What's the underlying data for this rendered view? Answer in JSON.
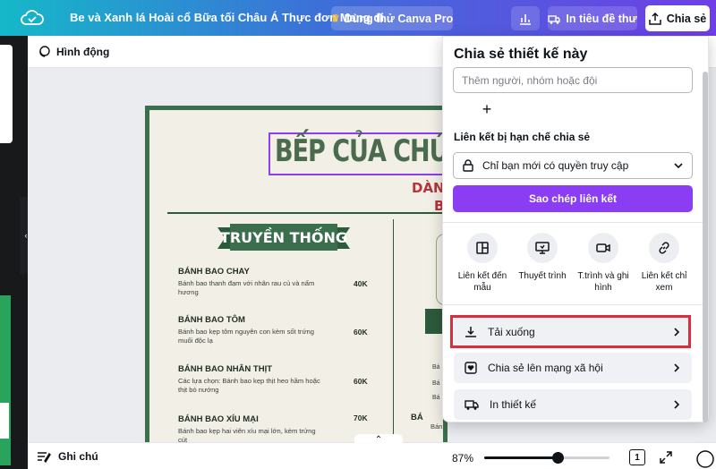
{
  "topbar": {
    "title": "Be và Xanh lá Hoài cổ Bữa tối Châu Á Thực đơn Mang đi",
    "try_pro": "Dùng thử Canva Pro",
    "print_label": "In tiêu đề thư",
    "share_label": "Chia sẻ"
  },
  "toolbar": {
    "animate_label": "Hình động"
  },
  "menu": {
    "title": "BẾP CỦA CHÚ NĂ",
    "subtitle_1": "DÀNH",
    "subtitle_2": "B",
    "section_title": "TRUYỀN THỐNG",
    "items": [
      {
        "name": "BÁNH BAO CHAY",
        "desc": "Bánh bao thanh đạm với nhân rau củ và nấm hương",
        "price": "40K"
      },
      {
        "name": "BÁNH BAO TÔM",
        "desc": "Bánh bao kẹp tôm nguyên con kèm sốt trứng muối độc lạ",
        "price": "60K"
      },
      {
        "name": "BÁNH BAO NHÂN THỊT",
        "desc": "Các lựa chọn: Bánh bao kẹp thịt heo hầm hoặc thịt bò nướng",
        "price": "60K"
      },
      {
        "name": "BÁNH BAO XÍU MẠI",
        "desc": "Bánh bao kẹp hai viên xíu mại lớn, kèm trứng cút",
        "price": "70K"
      }
    ],
    "right_dots": [
      "Bá",
      "Bá",
      "Bá"
    ],
    "right_name": "BÁ",
    "right_desc": "Bánh bao kẹp một lát thịt bò nướng,"
  },
  "share_panel": {
    "title": "Chia sẻ thiết kế này",
    "input_placeholder": "Thêm người, nhóm hoặc đội",
    "link_label": "Liên kết bị hạn chế chia sẻ",
    "access_value": "Chỉ bạn mới có quyền truy cập",
    "copy_link": "Sao chép liên kết",
    "options": [
      {
        "label": "Liên kết đến mẫu",
        "icon": "template-icon"
      },
      {
        "label": "Thuyết trình",
        "icon": "present-icon"
      },
      {
        "label": "T.trình và ghi hình",
        "icon": "record-icon"
      },
      {
        "label": "Liên kết chỉ xem",
        "icon": "link-icon"
      }
    ],
    "rows": [
      {
        "label": "Tải xuống",
        "icon": "download-icon"
      },
      {
        "label": "Chia sẻ lên mạng xã hội",
        "icon": "heart-icon"
      },
      {
        "label": "In thiết kế",
        "icon": "truck-icon"
      }
    ]
  },
  "bottombar": {
    "notes_label": "Ghi chú",
    "zoom": "87%",
    "zoom_fraction": 0.55,
    "page_number": "1"
  },
  "colors": {
    "accent": "#8b3df3",
    "highlight": "#d92f3c",
    "menu_green": "#3b6e4d"
  }
}
